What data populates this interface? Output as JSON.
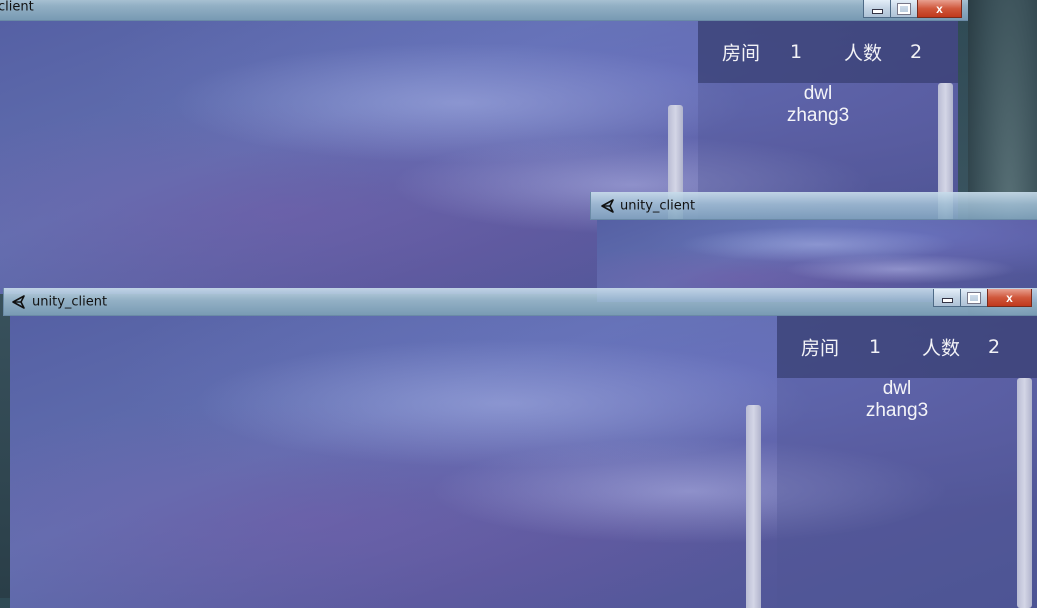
{
  "back_window": {
    "title": "client",
    "title_controls": {
      "min": "",
      "max": "",
      "close": "x"
    },
    "room_label": "房间",
    "room_value": "1",
    "count_label": "人数",
    "count_value": "2",
    "players": [
      "dwl",
      "zhang3"
    ]
  },
  "mid_window": {
    "title": "unity_client",
    "icon": "unity-icon"
  },
  "front_window": {
    "title": "unity_client",
    "icon": "unity-icon",
    "title_controls": {
      "min": "",
      "max": "",
      "close": "x"
    },
    "room_label": "房间",
    "room_value": "1",
    "count_label": "人数",
    "count_value": "2",
    "players": [
      "dwl",
      "zhang3"
    ]
  },
  "colors": {
    "viewport_base": "#5a64a8",
    "info_header": "#343c6e",
    "close_button": "#c8402a"
  }
}
